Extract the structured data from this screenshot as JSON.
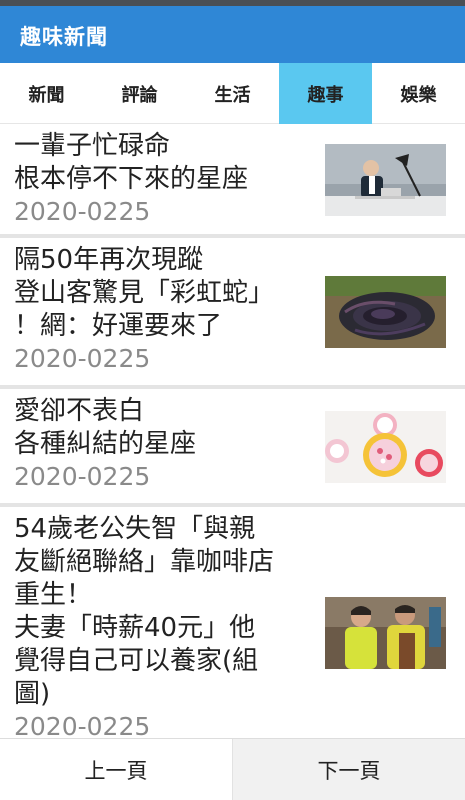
{
  "app": {
    "title": "趣味新聞"
  },
  "tabs": [
    {
      "label": "新聞"
    },
    {
      "label": "評論"
    },
    {
      "label": "生活"
    },
    {
      "label": "趣事"
    },
    {
      "label": "娛樂"
    }
  ],
  "active_tab": "趣事",
  "articles": [
    {
      "title": "一輩子忙碌命\n根本停不下來的星座",
      "date": "2020-0225",
      "image": "businessman-desk-lamp-photo"
    },
    {
      "title": "隔50年再次現蹤\n登山客驚見「彩虹蛇」\n！網：好運要來了",
      "date": "2020-0225",
      "image": "coiled-snake-photo"
    },
    {
      "title": "愛卻不表白\n各種糾結的星座",
      "date": "2020-0225",
      "image": "candy-bowls-photo"
    },
    {
      "title": "54歲老公失智「與親\n友斷絕聯絡」靠咖啡店\n重生！\n夫妻「時薪40元」他\n覺得自己可以養家(組\n圖)",
      "date": "2020-0225",
      "image": "couple-coffee-shop-photo"
    }
  ],
  "pagination": {
    "prev_label": "上一頁",
    "next_label": "下一頁"
  },
  "colors": {
    "appbar": "#2f87d6",
    "active_tab": "#5ac8f0",
    "date_text": "#8a8a8a"
  }
}
